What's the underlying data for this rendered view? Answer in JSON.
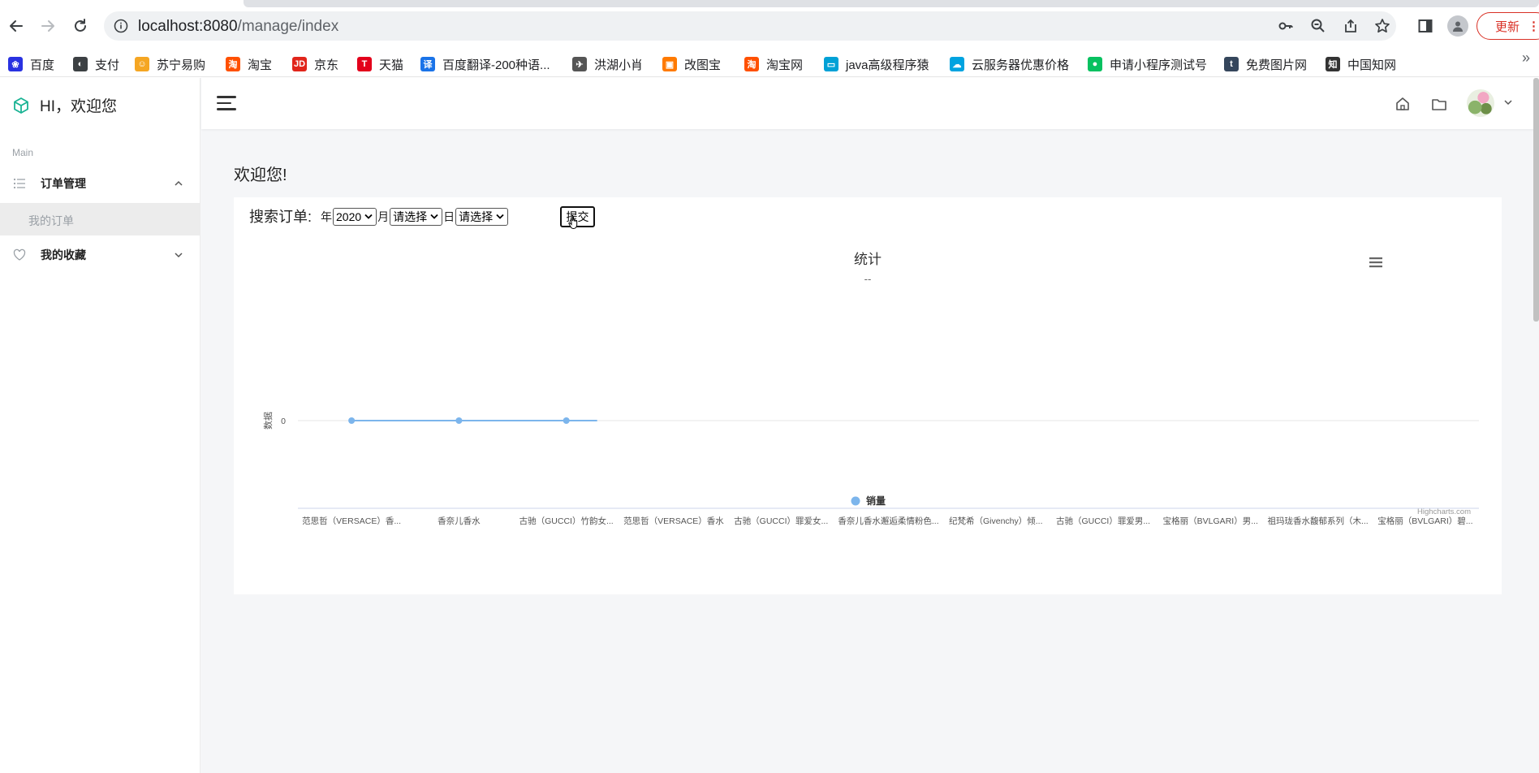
{
  "browser": {
    "url_host": "localhost:8080",
    "url_path": "/manage/index",
    "update_label": "更新",
    "bookmarks": [
      {
        "label": "百度",
        "icon": "baidu-icon",
        "color": "#2932e1"
      },
      {
        "label": "支付",
        "icon": "pay-icon",
        "color": "#3c4043"
      },
      {
        "label": "苏宁易购",
        "icon": "suning-icon",
        "color": "#f5a623"
      },
      {
        "label": "淘宝",
        "icon": "taobao-icon",
        "color": "#ff5000"
      },
      {
        "label": "京东",
        "icon": "jd-icon",
        "color": "#e1251b"
      },
      {
        "label": "天猫",
        "icon": "tmall-icon",
        "color": "#e3001b"
      },
      {
        "label": "百度翻译-200种语...",
        "icon": "translate-icon",
        "color": "#1a73e8"
      },
      {
        "label": "洪湖小肖",
        "icon": "bird-icon",
        "color": "#555555"
      },
      {
        "label": "改图宝",
        "icon": "gaitubao-icon",
        "color": "#ff7a00"
      },
      {
        "label": "淘宝网",
        "icon": "taobao-icon",
        "color": "#ff5000"
      },
      {
        "label": "java高级程序猿",
        "icon": "bilibili-icon",
        "color": "#00a1d6"
      },
      {
        "label": "云服务器优惠价格",
        "icon": "cloud-icon",
        "color": "#00a3e0"
      },
      {
        "label": "申请小程序测试号",
        "icon": "wechat-icon",
        "color": "#07c160"
      },
      {
        "label": "免费图片网",
        "icon": "tumblr-icon",
        "color": "#35465c"
      },
      {
        "label": "中国知网",
        "icon": "cnki-icon",
        "color": "#333333"
      }
    ]
  },
  "sidebar": {
    "brand": "HI，欢迎您",
    "section_label": "Main",
    "items": [
      {
        "label": "订单管理",
        "icon": "list-icon",
        "expanded": true
      },
      {
        "label": "我的收藏",
        "icon": "heart-icon",
        "expanded": false
      }
    ],
    "subitems": [
      {
        "label": "我的订单",
        "active": true
      }
    ]
  },
  "main": {
    "welcome": "欢迎您!",
    "search": {
      "label": "搜索订单:",
      "year_label": "年",
      "year_value": "2020",
      "month_label": "月",
      "month_value": "请选择",
      "day_label": "日",
      "day_value": "请选择",
      "submit_label": "提交"
    }
  },
  "chart_data": {
    "type": "line",
    "title": "统计",
    "subtitle": "--",
    "ylabel": "数据",
    "categories": [
      "范思哲（VERSACE）香...",
      "香奈儿香水",
      "古驰（GUCCI）竹韵女...",
      "范思哲（VERSACE）香水",
      "古驰（GUCCI）罪爱女...",
      "香奈儿香水邂逅柔情粉色...",
      "纪梵希（Givenchy）倾...",
      "古驰（GUCCI）罪爱男...",
      "宝格丽（BVLGARI）男...",
      "祖玛珑香水馥郁系列（木...",
      "宝格丽（BVLGARI）碧..."
    ],
    "yticks": [
      "0"
    ],
    "series": [
      {
        "name": "销量",
        "values": [
          0,
          0,
          0
        ],
        "color": "#7cb5ec"
      }
    ],
    "legend_position": "bottom-center",
    "credits": "Highcharts.com",
    "grid": true
  }
}
